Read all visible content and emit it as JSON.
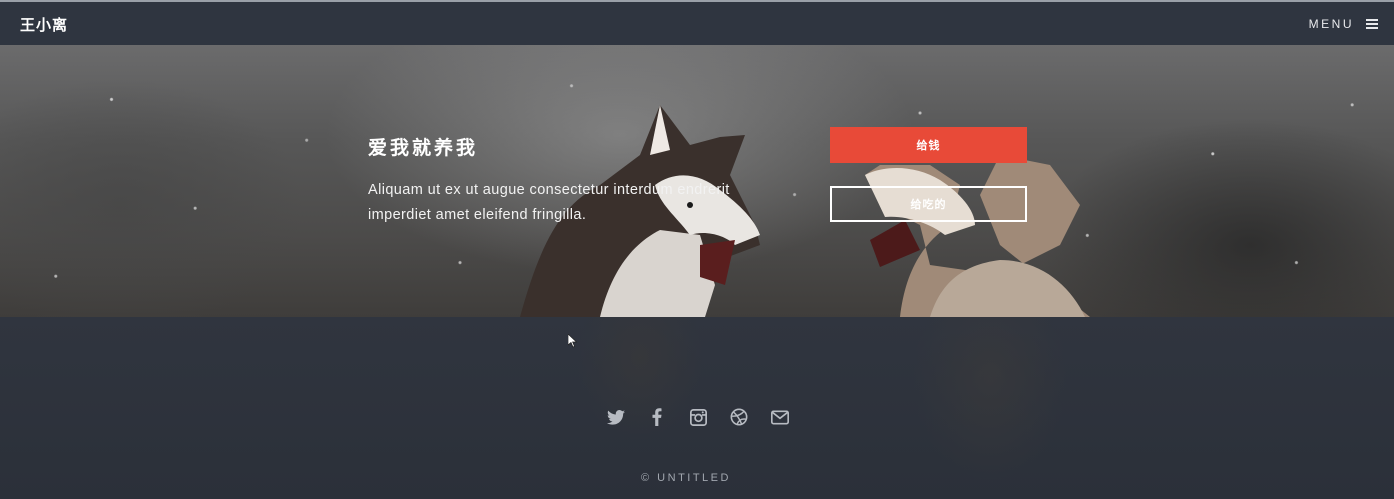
{
  "header": {
    "logo": "王小离",
    "menu_label": "MENU"
  },
  "banner": {
    "title": "爱我就养我",
    "description": "Aliquam ut ex ut augue consectetur interdum endrerit imperdiet amet eleifend fringilla.",
    "primary_button": "给钱",
    "secondary_button": "给吃的"
  },
  "footer": {
    "social_icons": [
      "twitter-icon",
      "facebook-icon",
      "instagram-icon",
      "dribbble-icon",
      "envelope-icon"
    ],
    "copyright": "© UNTITLED"
  },
  "colors": {
    "header_bg": "#2f3540",
    "accent": "#e84a38",
    "footer_bg": "#2e333d",
    "text_muted": "#a2a7af"
  }
}
